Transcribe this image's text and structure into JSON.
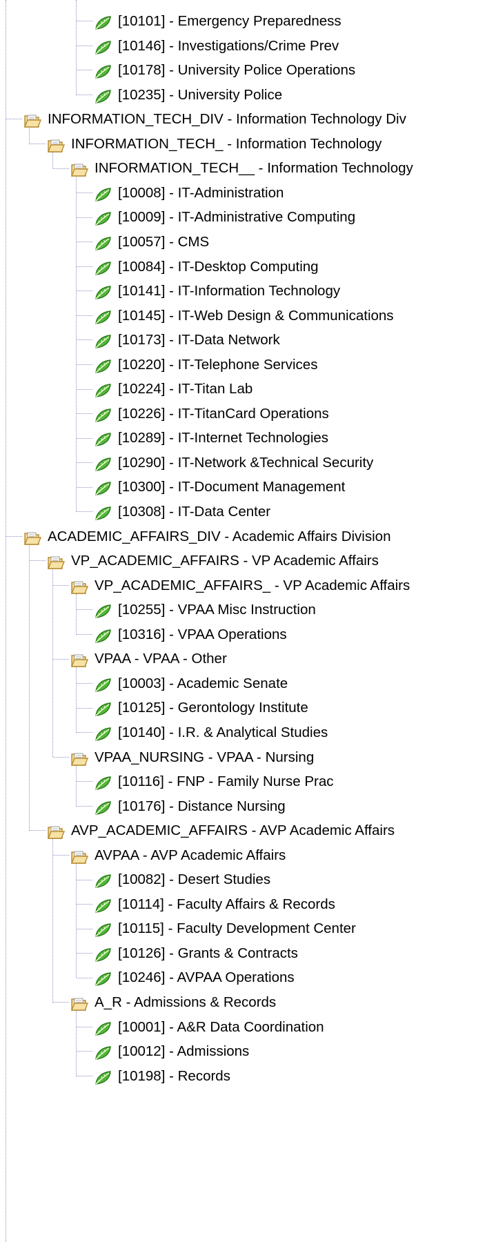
{
  "colors": {
    "connector": "#8a8fc4",
    "folder_fill": "#f1d894",
    "folder_edge": "#b88b32",
    "leaf_fill": "#53b53a",
    "leaf_edge": "#2a7a1c"
  },
  "tree": {
    "rows": [
      {
        "level": 3,
        "icon": "leaf-icon",
        "label": "[10101] - Emergency Preparedness"
      },
      {
        "level": 3,
        "icon": "leaf-icon",
        "label": "[10146] - Investigations/Crime Prev"
      },
      {
        "level": 3,
        "icon": "leaf-icon",
        "label": "[10178] - University Police Operations"
      },
      {
        "level": 3,
        "icon": "leaf-icon",
        "label": "[10235] - University Police"
      },
      {
        "level": 0,
        "icon": "open-folder-icon",
        "label": "INFORMATION_TECH_DIV - Information Technology Div"
      },
      {
        "level": 1,
        "icon": "open-folder-icon",
        "label": "INFORMATION_TECH_ - Information Technology"
      },
      {
        "level": 2,
        "icon": "open-folder-icon",
        "label": "INFORMATION_TECH__ - Information Technology"
      },
      {
        "level": 3,
        "icon": "leaf-icon",
        "label": "[10008] - IT-Administration"
      },
      {
        "level": 3,
        "icon": "leaf-icon",
        "label": "[10009] - IT-Administrative Computing"
      },
      {
        "level": 3,
        "icon": "leaf-icon",
        "label": "[10057] - CMS"
      },
      {
        "level": 3,
        "icon": "leaf-icon",
        "label": "[10084] - IT-Desktop Computing"
      },
      {
        "level": 3,
        "icon": "leaf-icon",
        "label": "[10141] - IT-Information Technology"
      },
      {
        "level": 3,
        "icon": "leaf-icon",
        "label": "[10145] - IT-Web Design & Communications"
      },
      {
        "level": 3,
        "icon": "leaf-icon",
        "label": "[10173] - IT-Data Network"
      },
      {
        "level": 3,
        "icon": "leaf-icon",
        "label": "[10220] - IT-Telephone Services"
      },
      {
        "level": 3,
        "icon": "leaf-icon",
        "label": "[10224] - IT-Titan Lab"
      },
      {
        "level": 3,
        "icon": "leaf-icon",
        "label": "[10226] - IT-TitanCard Operations"
      },
      {
        "level": 3,
        "icon": "leaf-icon",
        "label": "[10289] - IT-Internet Technologies"
      },
      {
        "level": 3,
        "icon": "leaf-icon",
        "label": "[10290] - IT-Network &Technical Security"
      },
      {
        "level": 3,
        "icon": "leaf-icon",
        "label": "[10300] - IT-Document Management"
      },
      {
        "level": 3,
        "icon": "leaf-icon",
        "label": "[10308] - IT-Data Center"
      },
      {
        "level": 0,
        "icon": "open-folder-icon",
        "label": "ACADEMIC_AFFAIRS_DIV - Academic Affairs Division"
      },
      {
        "level": 1,
        "icon": "open-folder-icon",
        "label": "VP_ACADEMIC_AFFAIRS - VP Academic Affairs"
      },
      {
        "level": 2,
        "icon": "open-folder-icon",
        "label": "VP_ACADEMIC_AFFAIRS_ - VP Academic Affairs"
      },
      {
        "level": 3,
        "icon": "leaf-icon",
        "label": "[10255] - VPAA Misc Instruction"
      },
      {
        "level": 3,
        "icon": "leaf-icon",
        "label": "[10316] - VPAA Operations"
      },
      {
        "level": 2,
        "icon": "open-folder-icon",
        "label": "VPAA - VPAA - Other"
      },
      {
        "level": 3,
        "icon": "leaf-icon",
        "label": "[10003] - Academic Senate"
      },
      {
        "level": 3,
        "icon": "leaf-icon",
        "label": "[10125] - Gerontology Institute"
      },
      {
        "level": 3,
        "icon": "leaf-icon",
        "label": "[10140] - I.R. & Analytical Studies"
      },
      {
        "level": 2,
        "icon": "open-folder-icon",
        "label": "VPAA_NURSING - VPAA - Nursing"
      },
      {
        "level": 3,
        "icon": "leaf-icon",
        "label": "[10116] - FNP - Family Nurse Prac"
      },
      {
        "level": 3,
        "icon": "leaf-icon",
        "label": "[10176] - Distance Nursing"
      },
      {
        "level": 1,
        "icon": "open-folder-icon",
        "label": "AVP_ACADEMIC_AFFAIRS - AVP Academic Affairs"
      },
      {
        "level": 2,
        "icon": "open-folder-icon",
        "label": "AVPAA - AVP Academic Affairs"
      },
      {
        "level": 3,
        "icon": "leaf-icon",
        "label": "[10082] - Desert Studies"
      },
      {
        "level": 3,
        "icon": "leaf-icon",
        "label": "[10114] - Faculty Affairs & Records"
      },
      {
        "level": 3,
        "icon": "leaf-icon",
        "label": "[10115] - Faculty Development Center"
      },
      {
        "level": 3,
        "icon": "leaf-icon",
        "label": "[10126] - Grants & Contracts"
      },
      {
        "level": 3,
        "icon": "leaf-icon",
        "label": "[10246] - AVPAA Operations"
      },
      {
        "level": 2,
        "icon": "open-folder-icon",
        "label": "A_R - Admissions & Records"
      },
      {
        "level": 3,
        "icon": "leaf-icon",
        "label": "[10001] - A&R Data Coordination"
      },
      {
        "level": 3,
        "icon": "leaf-icon",
        "label": "[10012] - Admissions"
      },
      {
        "level": 3,
        "icon": "leaf-icon",
        "label": "[10198] - Records"
      }
    ]
  }
}
